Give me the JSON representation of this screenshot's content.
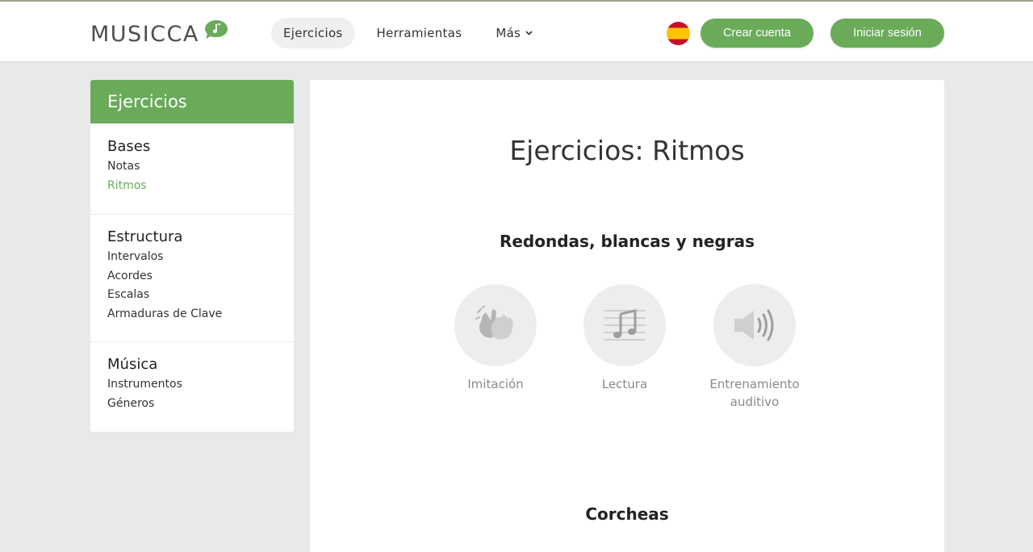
{
  "header": {
    "logo_text": "MUSICCA",
    "nav": [
      {
        "label": "Ejercicios",
        "active": true
      },
      {
        "label": "Herramientas",
        "active": false
      },
      {
        "label": "Más",
        "active": false
      }
    ],
    "language_flag": "spain-flag-icon",
    "create_account_label": "Crear cuenta",
    "login_label": "Iniciar sesión"
  },
  "sidebar": {
    "title": "Ejercicios",
    "sections": [
      {
        "title": "Bases",
        "items": [
          {
            "label": "Notas"
          },
          {
            "label": "Ritmos",
            "active": true
          }
        ]
      },
      {
        "title": "Estructura",
        "items": [
          {
            "label": "Intervalos"
          },
          {
            "label": "Acordes"
          },
          {
            "label": "Escalas"
          },
          {
            "label": "Armaduras de Clave"
          }
        ]
      },
      {
        "title": "Música",
        "items": [
          {
            "label": "Instrumentos"
          },
          {
            "label": "Géneros"
          }
        ]
      }
    ]
  },
  "main": {
    "page_title": "Ejercicios: Ritmos",
    "sections": [
      {
        "title": "Redondas, blancas y negras",
        "exercises": [
          {
            "label": "Imitación",
            "icon": "clapping-hands-icon"
          },
          {
            "label": "Lectura",
            "icon": "music-note-icon"
          },
          {
            "label": "Entrenamiento auditivo",
            "icon": "speaker-icon"
          }
        ]
      },
      {
        "title": "Corcheas"
      }
    ]
  },
  "colors": {
    "accent": "#6aab59",
    "background": "#e9e9e9",
    "icon_circle": "#ededed"
  }
}
